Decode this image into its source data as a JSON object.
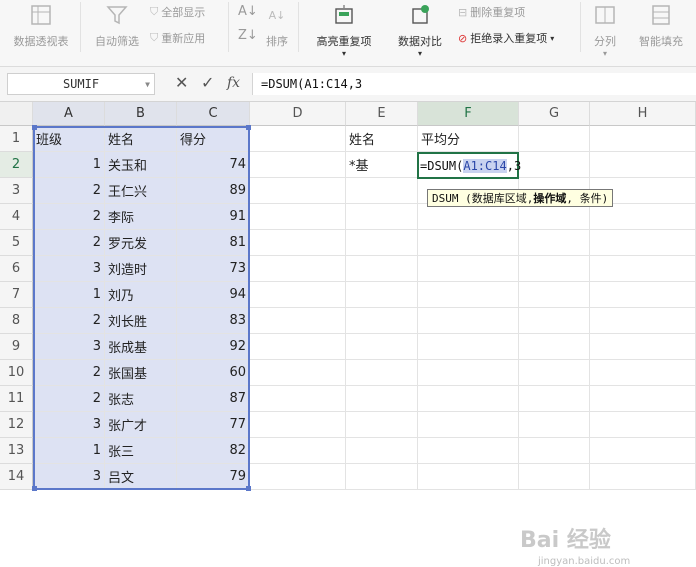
{
  "ribbon": {
    "pivot": "数据透视表",
    "autofilter": "自动筛选",
    "show_all": "全部显示",
    "reapply": "重新应用",
    "sort": "排序",
    "highlight_dup": "高亮重复项",
    "compare": "数据对比",
    "delete_dup": "删除重复项",
    "reject_dup": "拒绝录入重复项",
    "split": "分列",
    "smart_fill": "智能填充"
  },
  "formula_bar": {
    "name_box": "SUMIF",
    "cancel": "✕",
    "confirm": "✓",
    "fx": "fx",
    "formula": "=DSUM(A1:C14,3"
  },
  "columns": [
    "A",
    "B",
    "C",
    "D",
    "E",
    "F",
    "G",
    "H"
  ],
  "rows": [
    {
      "n": "1",
      "a": "班级",
      "b": "姓名",
      "c": "得分"
    },
    {
      "n": "2",
      "a": "1",
      "b": "关玉和",
      "c": "74"
    },
    {
      "n": "3",
      "a": "2",
      "b": "王仁兴",
      "c": "89"
    },
    {
      "n": "4",
      "a": "2",
      "b": "李际",
      "c": "91"
    },
    {
      "n": "5",
      "a": "2",
      "b": "罗元发",
      "c": "81"
    },
    {
      "n": "6",
      "a": "3",
      "b": "刘造时",
      "c": "73"
    },
    {
      "n": "7",
      "a": "1",
      "b": "刘乃",
      "c": "94"
    },
    {
      "n": "8",
      "a": "2",
      "b": "刘长胜",
      "c": "83"
    },
    {
      "n": "9",
      "a": "3",
      "b": "张成基",
      "c": "92"
    },
    {
      "n": "10",
      "a": "2",
      "b": "张国基",
      "c": "60"
    },
    {
      "n": "11",
      "a": "2",
      "b": "张志",
      "c": "87"
    },
    {
      "n": "12",
      "a": "3",
      "b": "张广才",
      "c": "77"
    },
    {
      "n": "13",
      "a": "1",
      "b": "张三",
      "c": "82"
    },
    {
      "n": "14",
      "a": "3",
      "b": "吕文",
      "c": "79"
    }
  ],
  "criteria": {
    "e1": "姓名",
    "f1": "平均分",
    "e2": "*基"
  },
  "active_cell": {
    "prefix": "=DSUM(",
    "ref": "A1:C14",
    "suffix": ",3"
  },
  "tooltip": {
    "func": "DSUM",
    "arg1": "数据库区域",
    "arg2": "操作域",
    "arg3": "条件",
    "text_before": "DSUM (数据库区域,",
    "text_bold": "操作域",
    "text_after": ", 条件)"
  },
  "watermark": {
    "logo": "Bai 经验",
    "url": "jingyan.baidu.com"
  }
}
